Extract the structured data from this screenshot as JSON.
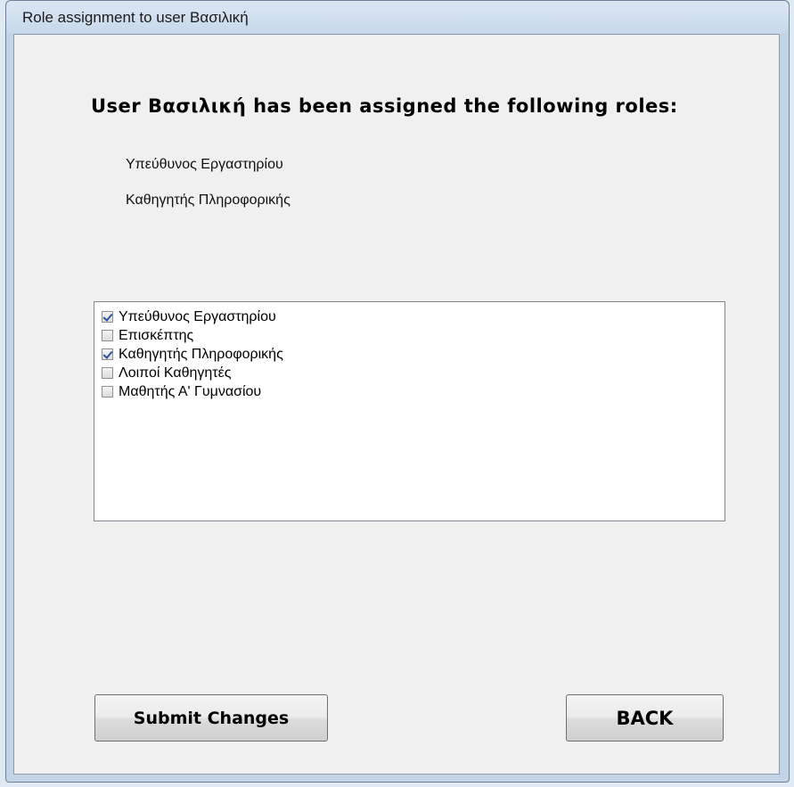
{
  "window": {
    "title": "Role assignment to user Βασιλική"
  },
  "main": {
    "heading": "User Βασιλική has been assigned the following roles:",
    "assigned_roles": [
      "Υπεύθυνος Εργαστηρίου",
      "Καθηγητής Πληροφορικής"
    ],
    "role_options": [
      {
        "label": "Υπεύθυνος Εργαστηρίου",
        "checked": true
      },
      {
        "label": "Επισκέπτης",
        "checked": false
      },
      {
        "label": "Καθηγητής Πληροφορικής",
        "checked": true
      },
      {
        "label": "Λοιποί Καθηγητές",
        "checked": false
      },
      {
        "label": "Μαθητής Α' Γυμνασίου",
        "checked": false
      }
    ]
  },
  "buttons": {
    "submit_label": "Submit Changes",
    "back_label": "BACK"
  }
}
